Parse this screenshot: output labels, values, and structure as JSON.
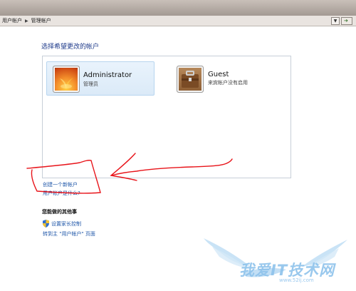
{
  "address_bar": {
    "breadcrumb": [
      "用户帐户",
      "管理帐户"
    ]
  },
  "main": {
    "heading": "选择希望更改的帐户",
    "accounts": [
      {
        "name": "Administrator",
        "subtitle": "管理员",
        "icon": "flower-avatar-icon"
      },
      {
        "name": "Guest",
        "subtitle": "来宾帐户没有启用",
        "icon": "briefcase-avatar-icon"
      }
    ],
    "links": {
      "create_account": "创建一个新帐户",
      "what_is_account": "用户帐户是什么?"
    },
    "other": {
      "title": "您能做的其他事",
      "parental_controls": "设置家长控制",
      "main_page": "转到主 \"用户帐户\" 页面"
    }
  },
  "watermark": {
    "text": "我爱IT技术网",
    "url": "www.52ij.com"
  },
  "colors": {
    "link": "#1e56a8",
    "heading": "#1e3a8a",
    "annotation": "#e8141a",
    "selection": "#dbeaf8"
  }
}
